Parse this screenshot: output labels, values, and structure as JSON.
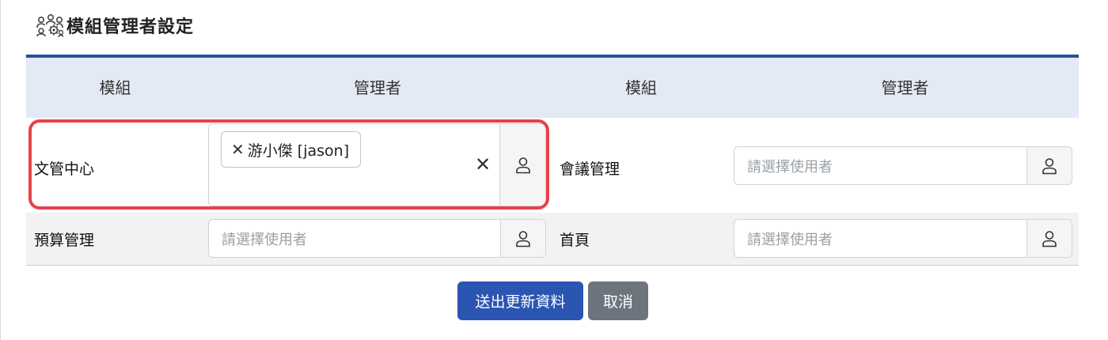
{
  "page": {
    "title": "模組管理者設定",
    "title_icon": "users-gear-icon"
  },
  "table": {
    "headers": [
      "模組",
      "管理者",
      "模組",
      "管理者"
    ],
    "rows": [
      {
        "left": {
          "module": "文管中心",
          "selected_users": [
            "游小傑 [jason]"
          ]
        },
        "right": {
          "module": "會議管理",
          "placeholder": "請選擇使用者"
        }
      },
      {
        "left": {
          "module": "預算管理",
          "placeholder": "請選擇使用者"
        },
        "right": {
          "module": "首頁",
          "placeholder": "請選擇使用者"
        }
      }
    ]
  },
  "actions": {
    "submit_label": "送出更新資料",
    "cancel_label": "取消"
  },
  "colors": {
    "primary": "#2a56b2",
    "secondary": "#6c757d",
    "header_bg": "#e3eaf6",
    "highlight": "#e8414b"
  }
}
